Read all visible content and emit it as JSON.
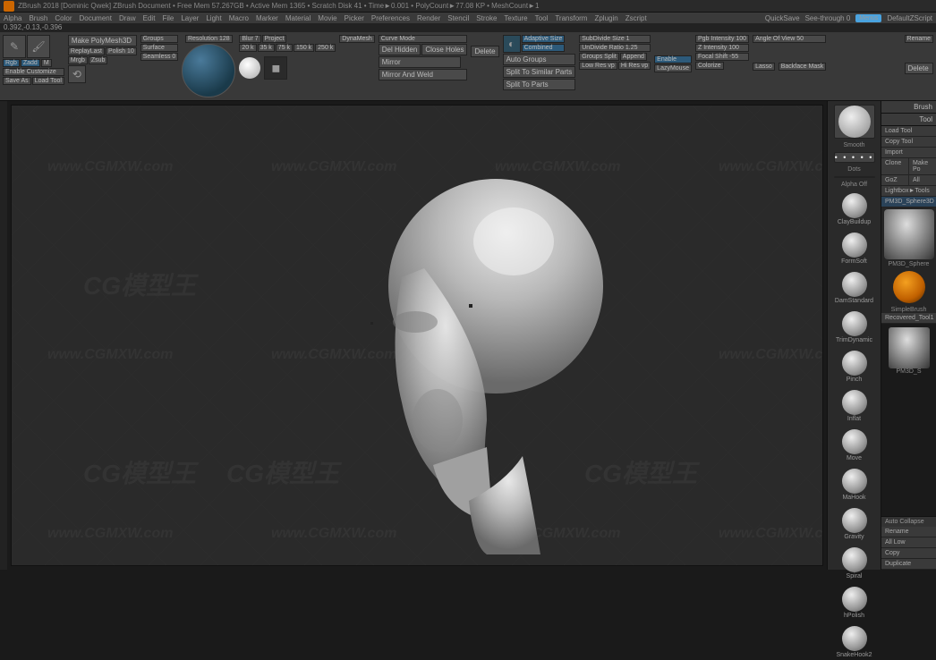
{
  "title_bar": "ZBrush 2018 [Dominic Qwek]  ZBrush Document  • Free Mem 57.267GB • Active Mem 1365 • Scratch Disk 41 • Time►0.001 • PolyCount►77.08 KP • MeshCount►1",
  "menu": [
    "Alpha",
    "Brush",
    "Color",
    "Document",
    "Draw",
    "Edit",
    "File",
    "Layer",
    "Light",
    "Macro",
    "Marker",
    "Material",
    "Movie",
    "Picker",
    "Preferences",
    "Render",
    "Stencil",
    "Stroke",
    "Texture",
    "Tool",
    "Transform",
    "Zplugin",
    "Zscript"
  ],
  "quick": {
    "save": "QuickSave",
    "seethrough": "See-through  0",
    "menus": "Menus",
    "script": "DefaultZScript"
  },
  "coords": "0.392,-0.13,-0.396",
  "shelf": {
    "edit": "Edit",
    "draw": "Draw",
    "make_poly": "Make PolyMesh3D",
    "groups": "Groups",
    "resolution": "Resolution 128",
    "replay": "ReplayLast",
    "polish": "Polish 10",
    "rgb": "Rgb",
    "zadd": "Zadd",
    "m": "M",
    "mrgb": "Mrgb",
    "zsub": "Zsub",
    "enable_custom": "Enable Customize",
    "surface": "Surface",
    "seamless": "Seamless 0",
    "saveas": "Save As",
    "loadtool": "Load Tool",
    "blur": "Blur 7",
    "project": "Project",
    "res_20": "20 k",
    "res_35": "35 k",
    "res_75": "75 k",
    "res_150": "150 k",
    "res_250": "250 k",
    "dynamesh": "DynaMesh",
    "curve": "Curve Mode",
    "del_hidden": "Del Hidden",
    "close_holes": "Close Holes",
    "delete": "Delete",
    "mirror": "Mirror",
    "mirror_weld": "Mirror And Weld",
    "adaptive": "Adaptive Size",
    "combined": "Combined",
    "auto_groups": "Auto Groups",
    "split_similar": "Split To Similar Parts",
    "split_parts": "Split To Parts",
    "subdivide": "SubDivide Size 1",
    "undivide": "UnDivide Ratio 1.25",
    "groups_split": "Groups Split",
    "append": "Append",
    "enable2": "Enable",
    "low_res": "Low Res vp",
    "hi_res": "Hi Res vp",
    "pg_intensity": "Pgb Intensity 100",
    "z_intensity": "Z Intensity 100",
    "focal": "Focal Shift -55",
    "colorize": "Colorize",
    "lazy": "LazyMouse",
    "lasso": "Lasso",
    "backface": "Backface Mask",
    "aov": "Angle Of View 50",
    "rename": "Rename",
    "delete2": "Delete"
  },
  "right_palettes": {
    "smooth": "Smooth",
    "dots": "Dots",
    "alpha_off": "Alpha Off",
    "brushes": [
      "ClayBuildup",
      "FormSoft",
      "DamStandard",
      "TrimDynamic",
      "Pinch",
      "Inflat",
      "Move",
      "MaHook",
      "Gravity",
      "Spiral",
      "hPolish",
      "SnakeHook2"
    ]
  },
  "far_panel": {
    "title": "Brush",
    "tool": "Tool",
    "load": "Load Tool",
    "copy": "Copy Tool",
    "import": "Import",
    "clone": "Clone",
    "makepo": "Make Po",
    "goz": "GoZ",
    "all": "All",
    "lightbox": "Lightbox►Tools",
    "active_tool": "PM3D_Sphere3D",
    "active_tool2": "PM3D_Sphere",
    "simple_brush": "SimpleBrush",
    "recovered": "Recovered_Tool1",
    "subtool": "PM3D_S",
    "auto_collapse": "Auto Collapse",
    "rename": "Rename",
    "all_low": "All Low",
    "copy2": "Copy",
    "duplicate": "Duplicate"
  },
  "watermarks": [
    "www.CGMXW.com",
    "CG模型王"
  ]
}
